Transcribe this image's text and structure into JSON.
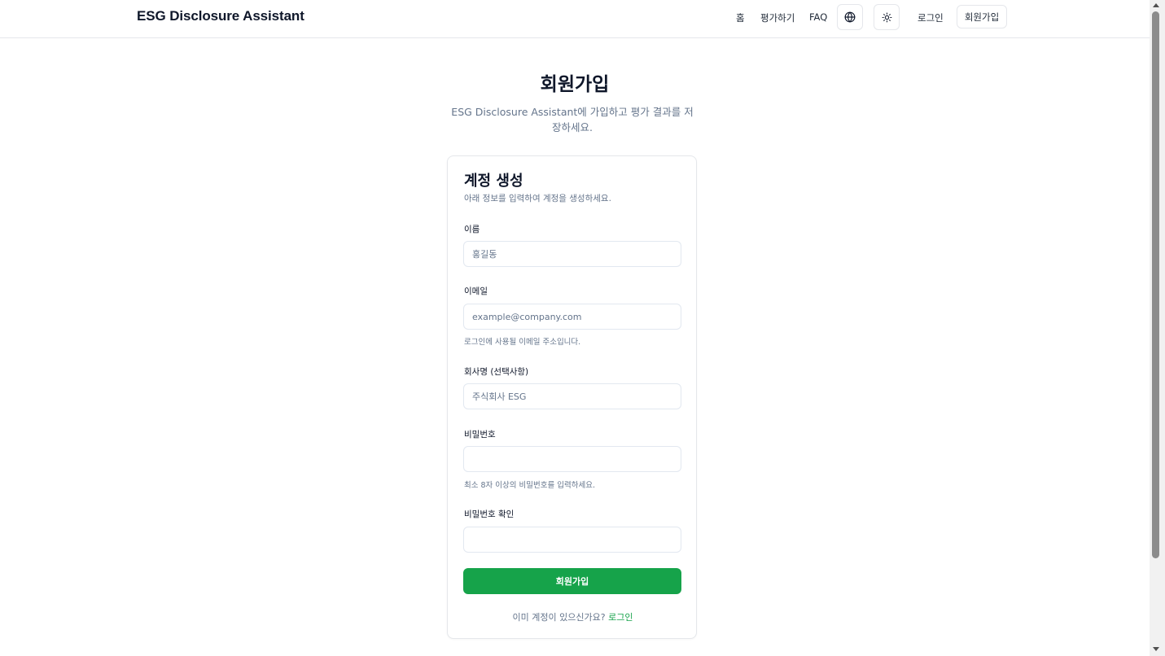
{
  "header": {
    "brand": "ESG Disclosure Assistant",
    "nav": {
      "home": "홈",
      "evaluate": "평가하기",
      "faq": "FAQ"
    },
    "icons": {
      "language": "globe-icon",
      "theme": "sun-icon"
    },
    "login": "로그인",
    "signup": "회원가입"
  },
  "hero": {
    "title": "회원가입",
    "subtitle": "ESG Disclosure Assistant에 가입하고 평가 결과를 저장하세요."
  },
  "form": {
    "title": "계정 생성",
    "description": "아래 정보를 입력하여 계정을 생성하세요.",
    "name": {
      "label": "이름",
      "placeholder": "홍길동"
    },
    "email": {
      "label": "이메일",
      "placeholder": "example@company.com",
      "hint": "로그인에 사용될 이메일 주소입니다."
    },
    "company": {
      "label": "회사명 (선택사항)",
      "placeholder": "주식회사 ESG"
    },
    "password": {
      "label": "비밀번호",
      "hint": "최소 8자 이상의 비밀번호를 입력하세요."
    },
    "password_confirm": {
      "label": "비밀번호 확인"
    },
    "submit": "회원가입",
    "footer_text": "이미 계정이 있으신가요? ",
    "footer_link": "로그인"
  },
  "colors": {
    "accent": "#16a34a",
    "text": "#0f172a",
    "muted": "#64748b",
    "border": "#e5e7eb"
  }
}
